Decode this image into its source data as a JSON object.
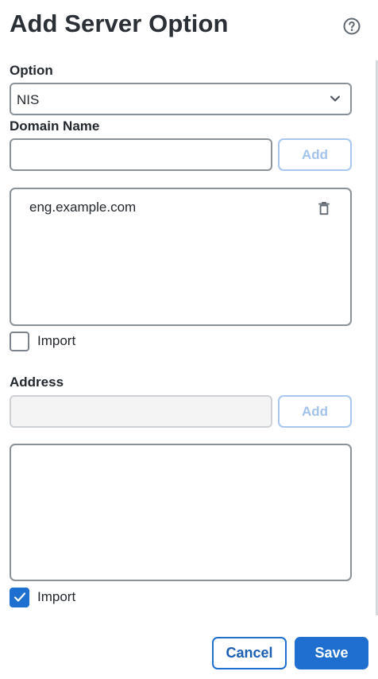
{
  "dialog": {
    "title": "Add Server Option"
  },
  "option": {
    "label": "Option",
    "selected": "NIS"
  },
  "domain": {
    "label": "Domain Name",
    "input_value": "",
    "add_label": "Add",
    "items": [
      {
        "text": "eng.example.com"
      }
    ],
    "import_label": "Import",
    "import_checked": false
  },
  "address": {
    "label": "Address",
    "input_value": "",
    "add_label": "Add",
    "items": [],
    "import_label": "Import",
    "import_checked": true
  },
  "footer": {
    "cancel_label": "Cancel",
    "save_label": "Save"
  },
  "colors": {
    "primary": "#1f6fd1",
    "disabled_add": "#a3c3ec",
    "border": "#8a9299"
  },
  "icons": {
    "help": "help-circle-icon",
    "chevron": "chevron-down-icon",
    "trash": "trash-icon",
    "check": "checkmark-icon"
  }
}
